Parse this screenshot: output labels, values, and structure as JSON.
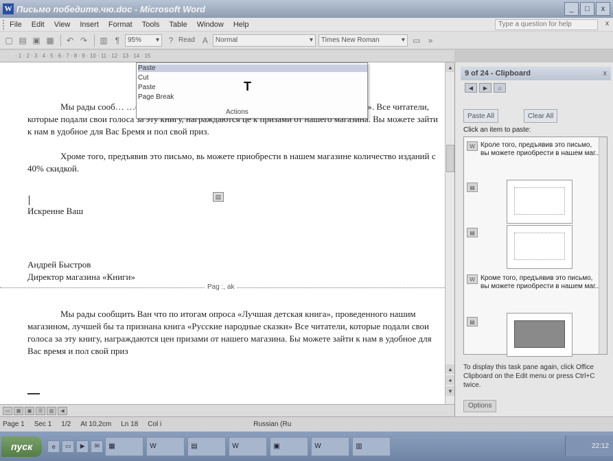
{
  "window": {
    "title": "Письмо победите.чю.doc - Microsoft Word",
    "controls": [
      "_",
      "□",
      "x"
    ]
  },
  "menubar": {
    "items": [
      "File",
      "Edit",
      "View",
      "Insert",
      "Format",
      "Tools",
      "Table",
      "Window",
      "Help"
    ],
    "ask_placeholder": "Type a question for help",
    "close": "x"
  },
  "toolbar": {
    "zoom": "95%",
    "read_label": "Read",
    "style": "Normal",
    "font": "Times New Roman",
    "pilcrow": "¶"
  },
  "dropdown": {
    "items": [
      "Paste",
      "Cut",
      "Paste",
      "Page Break"
    ],
    "big_letter": "T",
    "actions": "Actions"
  },
  "document": {
    "p1": "Мы рады сооб… …ская книга», проведенного нашим… …ские народные сказки». Все читатели, которые подали свои голоса за эту книгу, награждаются це к призами от нашего магазина. Вы можете зайти к нам в удобное для Вас Бремя и пол свой приз.",
    "p2": "Хроме того, предъявив это письмо, вь можете приобрести в нашем магазине количество изданий с 40% скидкой.",
    "closing": "Искренне Ваш",
    "sign_name": "Андрей Быстров",
    "sign_title": "Директор магазина «Книги»",
    "page_break": "Pag :, ak",
    "p3": "Мы рады сообщить Ван что по итогам опроса «Лучшая детская книга», проведенного нашим магазином, лучшей бы та признана книга «Русские народные сказки» Все читатели, которые подали свои голоса за эту книгу, награждаются цен призами от нашего магазина. Бы можете зайти к нам в удобное для Вас время и пол свой приз"
  },
  "taskpane": {
    "title": "9 of 24 - Clipboard",
    "close": "x",
    "paste_all": "Paste All",
    "clear_all": "Clear All",
    "click_hint": "Click an item to paste:",
    "entries": [
      "Кроле того, предъявив это письмо, вы можете приобрести в нашем маг...",
      "Кроме того, предъявив это письмо, вы можете приобрести в нашем маг..."
    ],
    "footer": "To display this task pane again, click Office Clipboard on the Edit menu or press Ctrl+C twice.",
    "options": "Options"
  },
  "statusbar": {
    "page": "Page 1",
    "sec": "Sec 1",
    "pos": "1/2",
    "at": "At 10,2cm",
    "ln": "Ln 18",
    "col": "Col i",
    "lang": "Russian (Ru"
  },
  "taskbar": {
    "start": "пуск",
    "clock": "22:12"
  }
}
